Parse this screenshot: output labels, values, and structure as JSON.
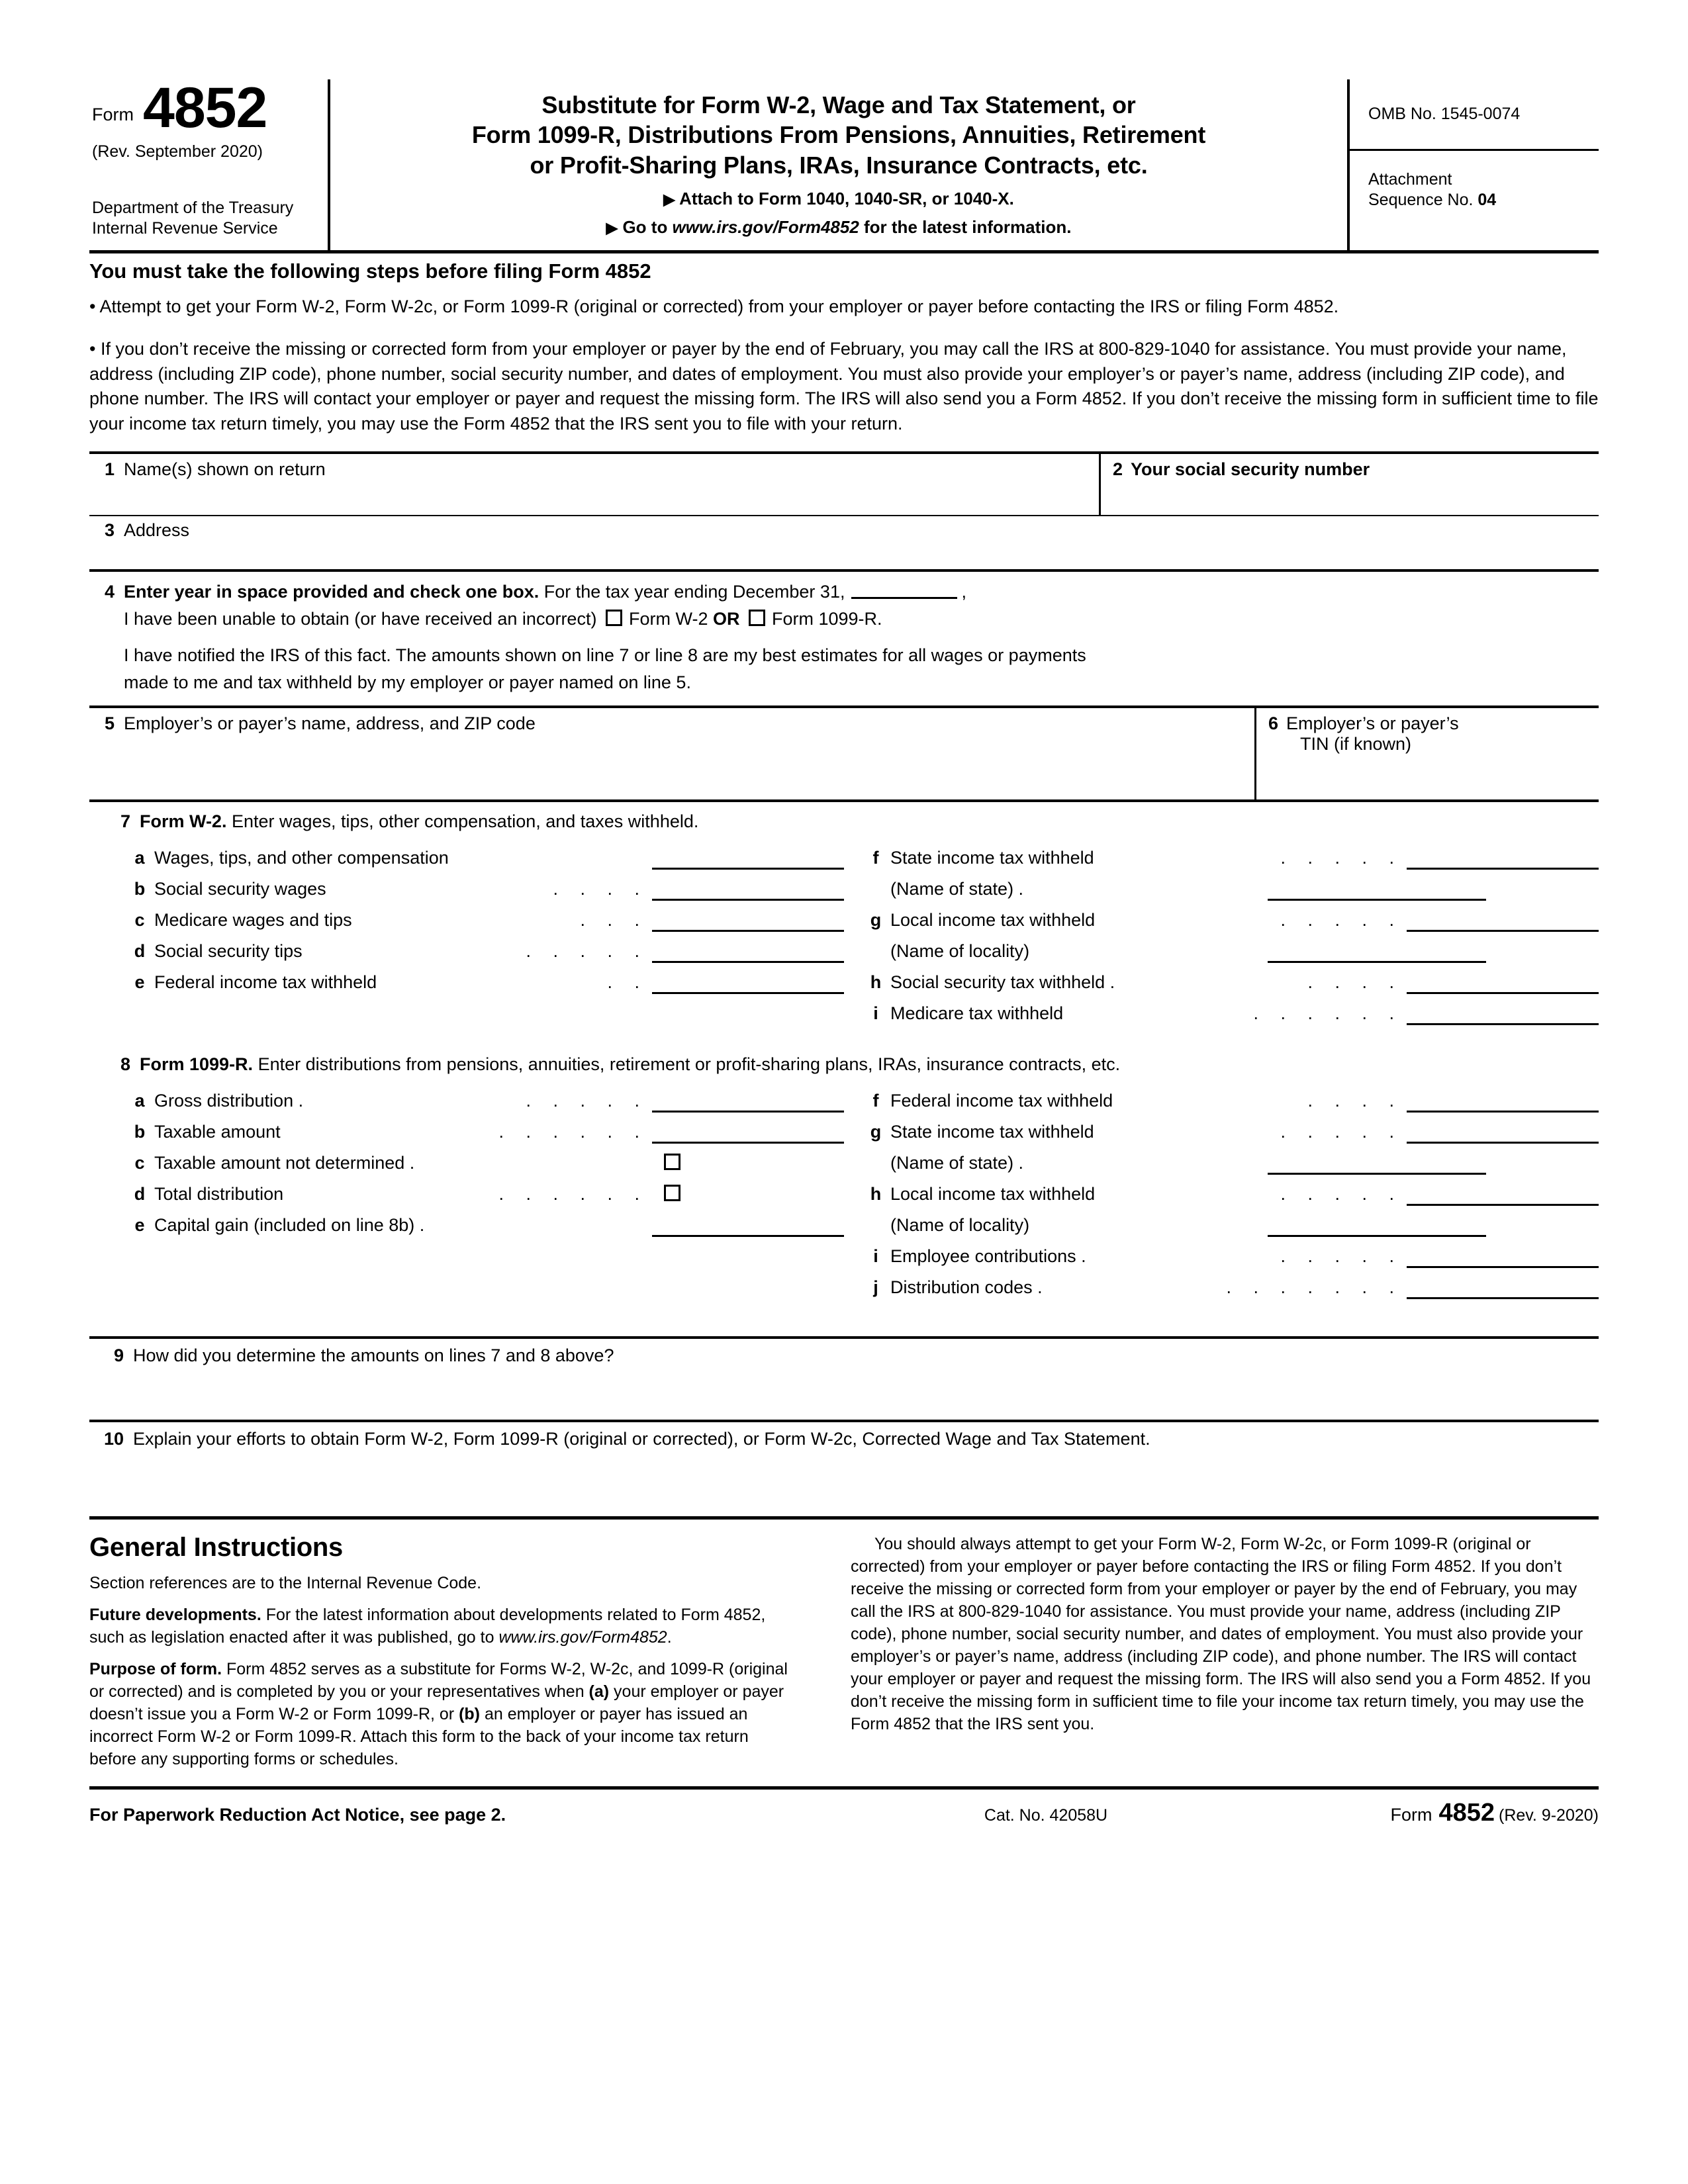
{
  "header": {
    "form_label": "Form",
    "form_number": "4852",
    "revision": "(Rev. September 2020)",
    "department_line1": "Department of the Treasury",
    "department_line2": "Internal Revenue Service",
    "title_line1": "Substitute for Form W-2, Wage and Tax Statement, or",
    "title_line2": "Form 1099-R, Distributions From Pensions, Annuities, Retirement",
    "title_line3": "or Profit-Sharing Plans, IRAs, Insurance Contracts, etc.",
    "attach_to": "Attach to Form 1040, 1040-SR, or 1040-X.",
    "goto_prefix": "Go to ",
    "goto_url": "www.irs.gov/Form4852",
    "goto_suffix": " for the latest information.",
    "omb": "OMB No. 1545-0074",
    "attachment_label1": "Attachment",
    "attachment_label2": "Sequence No. ",
    "attachment_number": "04"
  },
  "steps": {
    "heading": "You must take the following steps before filing Form 4852",
    "bullet1": "• Attempt to get your Form W-2, Form W-2c, or Form 1099-R (original or corrected) from your employer or payer before contacting the IRS or filing Form 4852.",
    "bullet2": "• If you don’t receive the missing or corrected form from your employer or payer by the end of February, you may call the IRS at 800-829-1040 for assistance. You must provide your name, address (including ZIP code), phone number, social security number, and dates of employment. You must also provide your employer’s or payer’s name, address (including ZIP code), and phone number. The IRS will contact your employer or payer and request the missing form. The IRS will also send you a Form 4852. If you don’t receive the missing form in sufficient time to file your income tax return timely, you may use the Form 4852 that the IRS sent you to file with your return."
  },
  "line1": {
    "num": "1",
    "label": "Name(s) shown on return"
  },
  "line2": {
    "num": "2",
    "label": "Your social security number"
  },
  "line3": {
    "num": "3",
    "label": "Address"
  },
  "line4": {
    "num": "4",
    "bold_part": "Enter year in space provided and check one box.",
    "rest": " For the tax year ending December 31,",
    "comma": ",",
    "row2_pre": "I have been unable to obtain (or have received an incorrect)",
    "cb1_label": "Form W-2",
    "or_label": "OR",
    "cb2_label": "Form 1099-R.",
    "row3_line1": "I have notified the IRS of this fact. The amounts shown on line 7 or line 8 are my best estimates for all wages or payments",
    "row3_line2": "made to me and tax withheld by my employer or payer named on line 5."
  },
  "line5": {
    "num": "5",
    "label": "Employer’s or payer’s name, address, and ZIP code"
  },
  "line6": {
    "num": "6",
    "label_line1": "Employer’s or payer’s",
    "label_line2": "TIN (if known)"
  },
  "line7": {
    "num": "7",
    "bold": "Form W-2.",
    "rest": " Enter wages, tips, other compensation, and taxes withheld.",
    "left_items": [
      {
        "letter": "a",
        "text": "Wages, tips, and other compensation",
        "leader": ""
      },
      {
        "letter": "b",
        "text": "Social security wages",
        "leader": ". . . ."
      },
      {
        "letter": "c",
        "text": "Medicare wages and tips",
        "leader": ". . ."
      },
      {
        "letter": "d",
        "text": "Social security tips",
        "leader": ". . . . ."
      },
      {
        "letter": "e",
        "text": "Federal income tax withheld",
        "leader": ". ."
      }
    ],
    "right_items": [
      {
        "letter": "f",
        "text": "State income tax withheld",
        "leader": ". . . . .",
        "kind": "amount"
      },
      {
        "letter": "",
        "text": "(Name of state) .",
        "leader": "",
        "kind": "name"
      },
      {
        "letter": "g",
        "text": "Local income tax withheld",
        "leader": ". . . . .",
        "kind": "amount"
      },
      {
        "letter": "",
        "text": "(Name of locality)",
        "leader": "",
        "kind": "name"
      },
      {
        "letter": "h",
        "text": "Social security tax withheld .",
        "leader": ". . . .",
        "kind": "amount"
      },
      {
        "letter": "i",
        "text": "Medicare tax withheld",
        "leader": ". . . . . .",
        "kind": "amount"
      }
    ]
  },
  "line8": {
    "num": "8",
    "bold": "Form 1099-R.",
    "rest": " Enter distributions from pensions, annuities, retirement or profit-sharing plans, IRAs, insurance contracts, etc.",
    "left_items": [
      {
        "letter": "a",
        "text": "Gross distribution .",
        "leader": ". . . . .",
        "kind": "amount"
      },
      {
        "letter": "b",
        "text": "Taxable amount",
        "leader": ". . . . . .",
        "kind": "amount"
      },
      {
        "letter": "c",
        "text": "Taxable amount not determined  .",
        "leader": "",
        "kind": "checkbox"
      },
      {
        "letter": "d",
        "text": "Total distribution",
        "leader": ". . . . . .",
        "kind": "checkbox"
      },
      {
        "letter": "e",
        "text": "Capital gain (included on line 8b)  .",
        "leader": "",
        "kind": "amount"
      }
    ],
    "right_items": [
      {
        "letter": "f",
        "text": "Federal income tax withheld",
        "leader": ". . . .",
        "kind": "amount"
      },
      {
        "letter": "g",
        "text": "State income tax withheld",
        "leader": ". . . . .",
        "kind": "amount"
      },
      {
        "letter": "",
        "text": "(Name of state) .",
        "leader": "",
        "kind": "name"
      },
      {
        "letter": "h",
        "text": "Local income tax withheld",
        "leader": ". . . . .",
        "kind": "amount"
      },
      {
        "letter": "",
        "text": "(Name of locality)",
        "leader": "",
        "kind": "name"
      },
      {
        "letter": "i",
        "text": "Employee contributions .",
        "leader": ". . . . .",
        "kind": "amount"
      },
      {
        "letter": "j",
        "text": "Distribution codes .",
        "leader": ". . . . . . .",
        "kind": "amount"
      }
    ]
  },
  "line9": {
    "num": "9",
    "label": "How did you determine the amounts on lines 7 and 8 above?"
  },
  "line10": {
    "num": "10",
    "label": "Explain your efforts to obtain Form W-2, Form 1099-R (original or corrected), or Form W-2c, Corrected Wage and Tax Statement."
  },
  "general": {
    "title": "General Instructions",
    "p1": "Section references are to the Internal Revenue Code.",
    "p2_bold": "Future developments.",
    "p2_rest": " For the latest information about developments related to Form 4852, such as legislation enacted after it was published, go to ",
    "p2_url": "www.irs.gov/Form4852",
    "p2_end": ".",
    "p3_bold": "Purpose of form.",
    "p3_rest_a": " Form 4852 serves as a substitute for Forms W-2, W-2c, and 1099-R (original or corrected) and is completed by you or your representatives when ",
    "p3_b_a": "(a)",
    "p3_rest_b": " your employer or payer doesn’t issue you a Form W-2 or Form 1099-R, or ",
    "p3_b_b": "(b)",
    "p3_rest_c": " an employer or payer has issued an incorrect Form W-2 or Form 1099-R. Attach this form to the back of your income tax return before any supporting forms or schedules.",
    "right_p": "You should always attempt to get your Form W-2, Form W-2c, or Form 1099-R (original or corrected) from your employer or payer before contacting the IRS or filing Form 4852. If you don’t receive the missing or corrected form from your employer or payer by the end of February, you may call the IRS at 800-829-1040 for assistance. You must provide your name, address (including ZIP code), phone number, social security number, and dates of employment. You must also provide your employer’s or payer’s name, address (including ZIP code), and phone number. The IRS will contact your employer or payer and request the missing form. The IRS will also send you a Form 4852. If you don’t receive the missing form in sufficient time to file your income tax return timely, you may use the Form 4852 that the IRS sent you."
  },
  "footer": {
    "notice": "For Paperwork Reduction Act Notice, see page 2.",
    "cat_no": "Cat. No. 42058U",
    "form_word": "Form",
    "form_number": "4852",
    "revision": "(Rev. 9-2020)"
  }
}
